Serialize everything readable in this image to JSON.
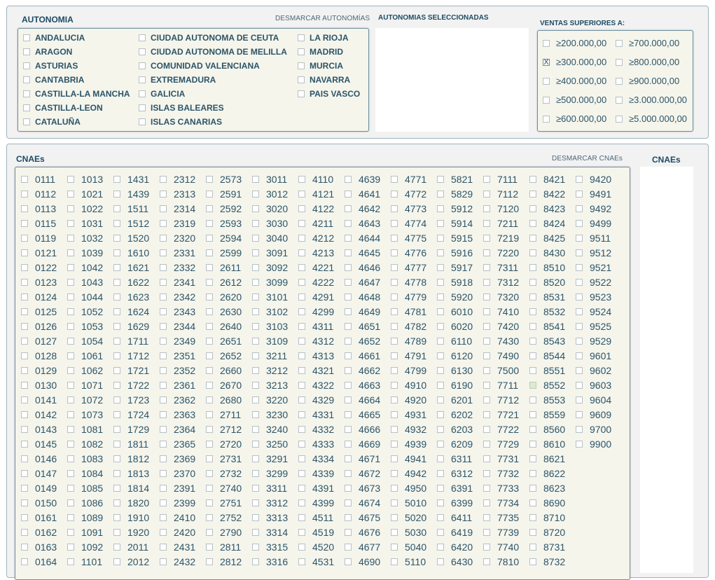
{
  "autonomia": {
    "title": "AUTONOMIA",
    "clear_label": "DESMARCAR AUTONOMÍAS",
    "selected_title": "AUTONOMIAS SELECCIONADAS",
    "regions": [
      [
        "ANDALUCIA",
        "ARAGON",
        "ASTURIAS",
        "CANTABRIA",
        "CASTILLA-LA MANCHA",
        "CASTILLA-LEON",
        "CATALUÑA"
      ],
      [
        "CIUDAD AUTONOMA DE CEUTA",
        "CIUDAD AUTONOMA DE MELILLA",
        "COMUNIDAD VALENCIANA",
        "EXTREMADURA",
        "GALICIA",
        "ISLAS BALEARES",
        "ISLAS CANARIAS"
      ],
      [
        "LA RIOJA",
        "MADRID",
        "MURCIA",
        "NAVARRA",
        "PAIS VASCO"
      ]
    ]
  },
  "ventas": {
    "title": "VENTAS  SUPERIORES A:",
    "columns": [
      [
        "≥200.000,00",
        "≥300.000,00",
        "≥400.000,00",
        "≥500.000,00",
        "≥600.000,00"
      ],
      [
        "≥700.000,00",
        "≥800.000,00",
        "≥900.000,00",
        "≥3.000.000,00",
        "≥5.000.000,00"
      ]
    ],
    "checked": [
      "≥300.000,00"
    ],
    "check_mark": "X"
  },
  "cnaes": {
    "title": "CNAEs",
    "clear_label": "DESMARCAR CNAEs",
    "selected_title": "CNAEs",
    "highlighted": [
      "8552"
    ],
    "columns": [
      [
        "0111",
        "0112",
        "0113",
        "0115",
        "0119",
        "0121",
        "0122",
        "0123",
        "0124",
        "0125",
        "0126",
        "0127",
        "0128",
        "0129",
        "0130",
        "0141",
        "0142",
        "0143",
        "0145",
        "0146",
        "0147",
        "0149",
        "0150",
        "0161",
        "0162",
        "0163",
        "0164"
      ],
      [
        "1013",
        "1021",
        "1022",
        "1031",
        "1032",
        "1039",
        "1042",
        "1043",
        "1044",
        "1052",
        "1053",
        "1054",
        "1061",
        "1062",
        "1071",
        "1072",
        "1073",
        "1081",
        "1082",
        "1083",
        "1084",
        "1085",
        "1086",
        "1089",
        "1091",
        "1092",
        "1101"
      ],
      [
        "1431",
        "1439",
        "1511",
        "1512",
        "1520",
        "1610",
        "1621",
        "1622",
        "1623",
        "1624",
        "1629",
        "1711",
        "1712",
        "1721",
        "1722",
        "1723",
        "1724",
        "1729",
        "1811",
        "1812",
        "1813",
        "1814",
        "1820",
        "1910",
        "1920",
        "2011",
        "2012"
      ],
      [
        "2312",
        "2313",
        "2314",
        "2319",
        "2320",
        "2331",
        "2332",
        "2341",
        "2342",
        "2343",
        "2344",
        "2349",
        "2351",
        "2352",
        "2361",
        "2362",
        "2363",
        "2364",
        "2365",
        "2369",
        "2370",
        "2391",
        "2399",
        "2410",
        "2420",
        "2431",
        "2432"
      ],
      [
        "2573",
        "2591",
        "2592",
        "2593",
        "2594",
        "2599",
        "2611",
        "2612",
        "2620",
        "2630",
        "2640",
        "2651",
        "2652",
        "2660",
        "2670",
        "2680",
        "2711",
        "2712",
        "2720",
        "2731",
        "2732",
        "2740",
        "2751",
        "2752",
        "2790",
        "2811",
        "2812"
      ],
      [
        "3011",
        "3012",
        "3020",
        "3030",
        "3040",
        "3091",
        "3092",
        "3099",
        "3101",
        "3102",
        "3103",
        "3109",
        "3211",
        "3212",
        "3213",
        "3220",
        "3230",
        "3240",
        "3250",
        "3291",
        "3299",
        "3311",
        "3312",
        "3313",
        "3314",
        "3315",
        "3316"
      ],
      [
        "4110",
        "4121",
        "4122",
        "4211",
        "4212",
        "4213",
        "4221",
        "4222",
        "4291",
        "4299",
        "4311",
        "4312",
        "4313",
        "4321",
        "4322",
        "4329",
        "4331",
        "4332",
        "4333",
        "4334",
        "4339",
        "4391",
        "4399",
        "4511",
        "4519",
        "4520",
        "4531"
      ],
      [
        "4639",
        "4641",
        "4642",
        "4643",
        "4644",
        "4645",
        "4646",
        "4647",
        "4648",
        "4649",
        "4651",
        "4652",
        "4661",
        "4662",
        "4663",
        "4664",
        "4665",
        "4666",
        "4669",
        "4671",
        "4672",
        "4673",
        "4674",
        "4675",
        "4676",
        "4677",
        "4690"
      ],
      [
        "4771",
        "4772",
        "4773",
        "4774",
        "4775",
        "4776",
        "4777",
        "4778",
        "4779",
        "4781",
        "4782",
        "4789",
        "4791",
        "4799",
        "4910",
        "4920",
        "4931",
        "4932",
        "4939",
        "4941",
        "4942",
        "4950",
        "5010",
        "5020",
        "5030",
        "5040",
        "5110"
      ],
      [
        "5821",
        "5829",
        "5912",
        "5914",
        "5915",
        "5916",
        "5917",
        "5918",
        "5920",
        "6010",
        "6020",
        "6110",
        "6120",
        "6130",
        "6190",
        "6201",
        "6202",
        "6203",
        "6209",
        "6311",
        "6312",
        "6391",
        "6399",
        "6411",
        "6419",
        "6420",
        "6430"
      ],
      [
        "7111",
        "7112",
        "7120",
        "7211",
        "7219",
        "7220",
        "7311",
        "7312",
        "7320",
        "7410",
        "7420",
        "7430",
        "7490",
        "7500",
        "7711",
        "7712",
        "7721",
        "7722",
        "7729",
        "7731",
        "7732",
        "7733",
        "7734",
        "7735",
        "7739",
        "7740",
        "7810"
      ],
      [
        "8421",
        "8422",
        "8423",
        "8424",
        "8425",
        "8430",
        "8510",
        "8520",
        "8531",
        "8532",
        "8541",
        "8543",
        "8544",
        "8551",
        "8552",
        "8553",
        "8559",
        "8560",
        "8610",
        "8621",
        "8622",
        "8623",
        "8690",
        "8710",
        "8720",
        "8731",
        "8732"
      ],
      [
        "9420",
        "9491",
        "9492",
        "9499",
        "9511",
        "9512",
        "9521",
        "9522",
        "9523",
        "9524",
        "9525",
        "9529",
        "9601",
        "9602",
        "9603",
        "9604",
        "9609",
        "9700",
        "9900"
      ]
    ]
  }
}
